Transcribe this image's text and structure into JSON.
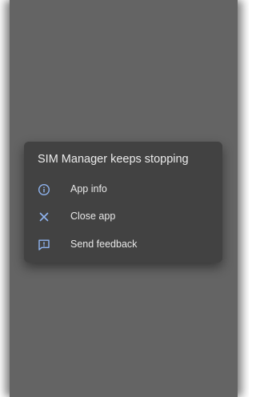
{
  "dialog": {
    "title": "SIM Manager keeps stopping",
    "items": [
      {
        "label": "App info",
        "icon": "info-icon"
      },
      {
        "label": "Close app",
        "icon": "close-icon"
      },
      {
        "label": "Send feedback",
        "icon": "feedback-icon"
      }
    ]
  },
  "colors": {
    "scrim": "#646464",
    "dialog_background": "#424242",
    "icon_accent": "#8fb4f0",
    "text": "#e8e8e8"
  }
}
